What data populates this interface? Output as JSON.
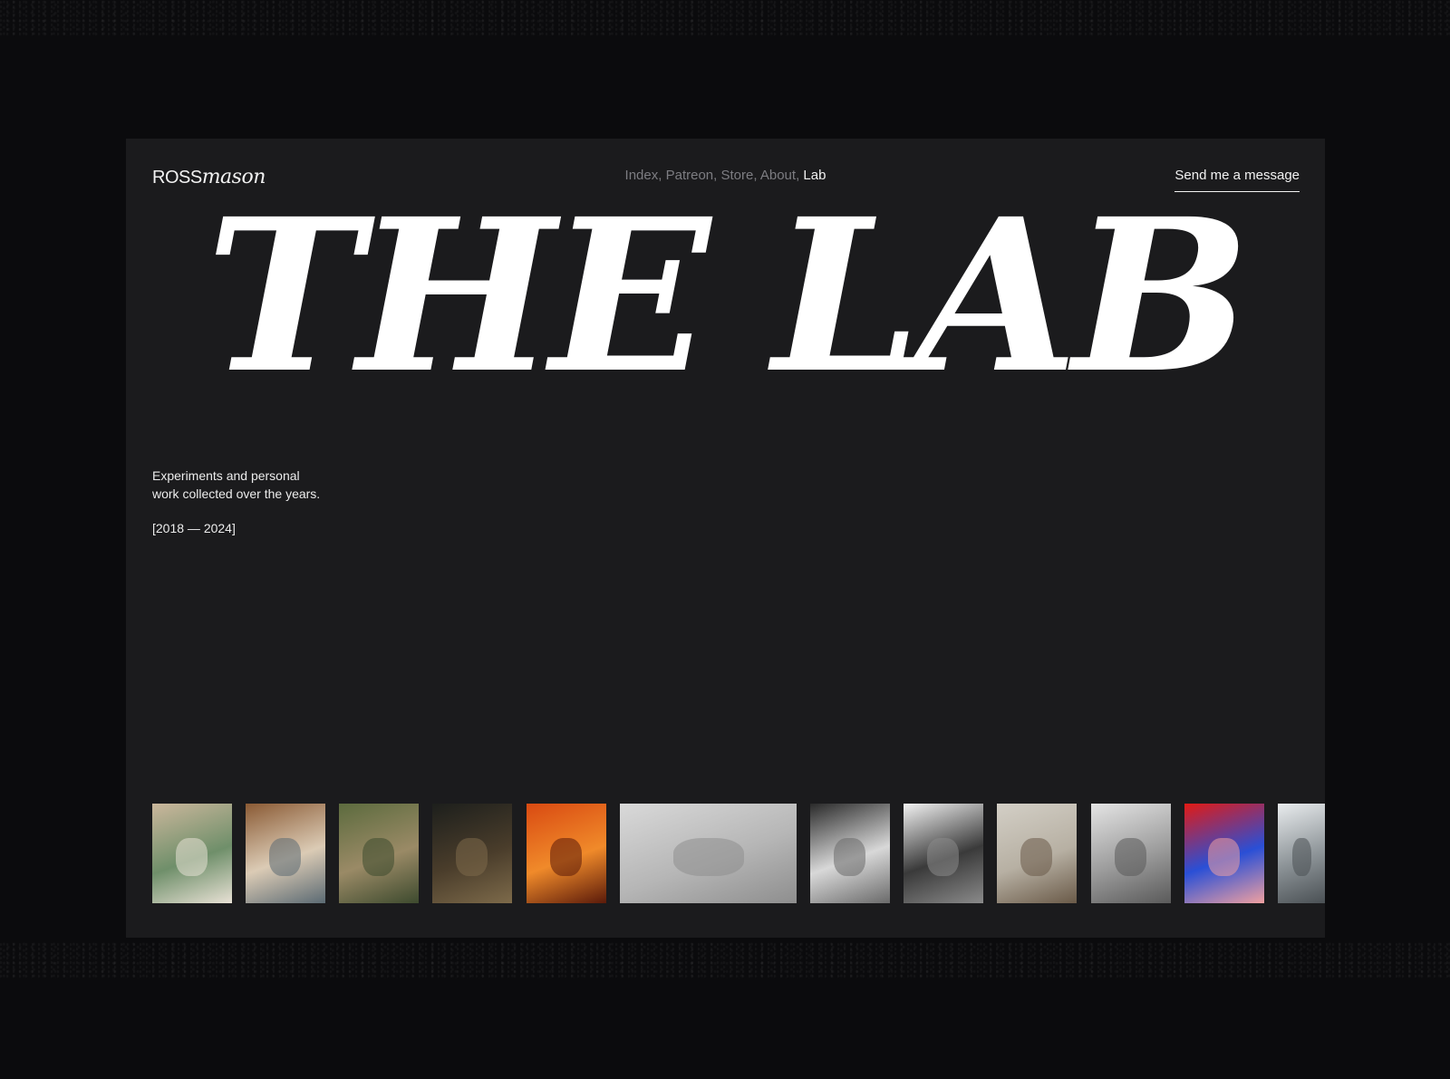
{
  "logo": {
    "part1": "ROSS",
    "part2": "mason"
  },
  "nav": {
    "items": [
      {
        "label": "Index",
        "sep": ", ",
        "active": false
      },
      {
        "label": "Patreon",
        "sep": ", ",
        "active": false
      },
      {
        "label": "Store",
        "sep": ", ",
        "active": false
      },
      {
        "label": "About",
        "sep": ", ",
        "active": false
      },
      {
        "label": "Lab",
        "sep": "",
        "active": true
      }
    ]
  },
  "cta": {
    "label": "Send me a message"
  },
  "hero": {
    "title": "THE LAB"
  },
  "intro": {
    "line1": "Experiments and personal",
    "line2": "work collected over the years.",
    "years": "[2018 — 2024]"
  },
  "thumbnails": [
    {
      "subject": "living room interior",
      "colors": [
        "#cbb79c",
        "#6f8f6a",
        "#e8e1d5"
      ]
    },
    {
      "subject": "a-frame cabin window",
      "colors": [
        "#8a5a34",
        "#dbcbb5",
        "#5b6a73"
      ]
    },
    {
      "subject": "garden landscape",
      "colors": [
        "#5c6b3e",
        "#9a8a66",
        "#3d4a2e"
      ]
    },
    {
      "subject": "night forest scene",
      "colors": [
        "#1d1f1c",
        "#4a3d2b",
        "#7d6a4a"
      ]
    },
    {
      "subject": "orange perfume bottle",
      "colors": [
        "#d94a12",
        "#f08a2a",
        "#5a1a0a"
      ]
    },
    {
      "subject": "white sculpture room",
      "colors": [
        "#d9d9d9",
        "#b6b6b6",
        "#8e8e8e"
      ]
    },
    {
      "subject": "monochrome noise pattern",
      "colors": [
        "#2a2a2a",
        "#d8d8d8",
        "#6a6a6a"
      ]
    },
    {
      "subject": "chrome vases",
      "colors": [
        "#f2f2f2",
        "#3a3a3a",
        "#8a8a8a"
      ]
    },
    {
      "subject": "sunlit room",
      "colors": [
        "#d3cfc6",
        "#b7b0a3",
        "#6a5a48"
      ]
    },
    {
      "subject": "car grid",
      "colors": [
        "#e4e4e4",
        "#9c9c9c",
        "#5a5a5a"
      ]
    },
    {
      "subject": "red blue object",
      "colors": [
        "#e21a14",
        "#2a4fd6",
        "#f0a0a0"
      ]
    },
    {
      "subject": "grey device",
      "colors": [
        "#e9ecee",
        "#8d9498",
        "#4a5054"
      ]
    }
  ]
}
